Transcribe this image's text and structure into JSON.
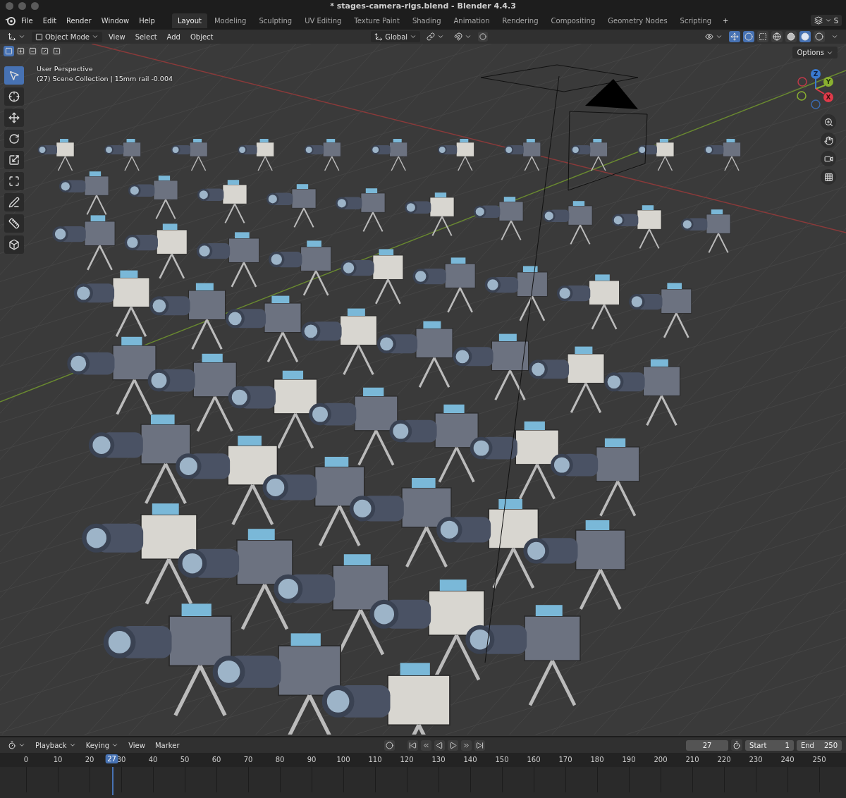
{
  "window": {
    "title": "* stages-camera-rigs.blend - Blender 4.4.3"
  },
  "menu": [
    "File",
    "Edit",
    "Render",
    "Window",
    "Help"
  ],
  "workspaces": [
    {
      "label": "Layout",
      "selected": true
    },
    {
      "label": "Modeling",
      "selected": false
    },
    {
      "label": "Sculpting",
      "selected": false
    },
    {
      "label": "UV Editing",
      "selected": false
    },
    {
      "label": "Texture Paint",
      "selected": false
    },
    {
      "label": "Shading",
      "selected": false
    },
    {
      "label": "Animation",
      "selected": false
    },
    {
      "label": "Rendering",
      "selected": false
    },
    {
      "label": "Compositing",
      "selected": false
    },
    {
      "label": "Geometry Nodes",
      "selected": false
    },
    {
      "label": "Scripting",
      "selected": false
    }
  ],
  "add_workspace": "+",
  "scene_selector": "S",
  "viewport_header": {
    "mode": "Object Mode",
    "menus": [
      "View",
      "Select",
      "Add",
      "Object"
    ],
    "orientation": "Global",
    "shading": [
      {
        "kind": "wireframe",
        "selected": false
      },
      {
        "kind": "solid",
        "selected": false
      },
      {
        "kind": "material",
        "selected": true
      },
      {
        "kind": "rendered",
        "selected": false
      }
    ]
  },
  "select_modes": [
    {
      "kind": "set",
      "selected": true
    },
    {
      "kind": "extend",
      "selected": false
    },
    {
      "kind": "subtract",
      "selected": false
    },
    {
      "kind": "invert",
      "selected": false
    },
    {
      "kind": "intersect",
      "selected": false
    }
  ],
  "options": "Options",
  "overlay_text": [
    "User Perspective",
    "(27) Scene Collection | 15mm rail -0.004"
  ],
  "tools": [
    {
      "kind": "select",
      "selected": true
    },
    {
      "kind": "cursor",
      "selected": false
    },
    {
      "kind": "move",
      "selected": false
    },
    {
      "kind": "rotate",
      "selected": false
    },
    {
      "kind": "scale",
      "selected": false
    },
    {
      "kind": "transform",
      "selected": false
    },
    {
      "kind": "annotate",
      "selected": false
    },
    {
      "kind": "measure",
      "selected": false
    },
    {
      "kind": "add-cube",
      "selected": false
    }
  ],
  "gizmo": {
    "x": "X",
    "y": "Y",
    "z": "Z"
  },
  "timeline": {
    "menus": [
      {
        "label": "Playback",
        "dropdown": true
      },
      {
        "label": "Keying",
        "dropdown": true
      },
      {
        "label": "View",
        "dropdown": false
      },
      {
        "label": "Marker",
        "dropdown": false
      }
    ],
    "current_frame": "27",
    "start_label": "Start",
    "start": "1",
    "end_label": "End",
    "end": "250",
    "playhead": "27",
    "ticks": [
      "0",
      "10",
      "20",
      "30",
      "40",
      "50",
      "60",
      "70",
      "80",
      "90",
      "100",
      "110",
      "120",
      "130",
      "140",
      "150",
      "160",
      "170",
      "180",
      "190",
      "200",
      "210",
      "220",
      "230",
      "240",
      "250"
    ]
  }
}
